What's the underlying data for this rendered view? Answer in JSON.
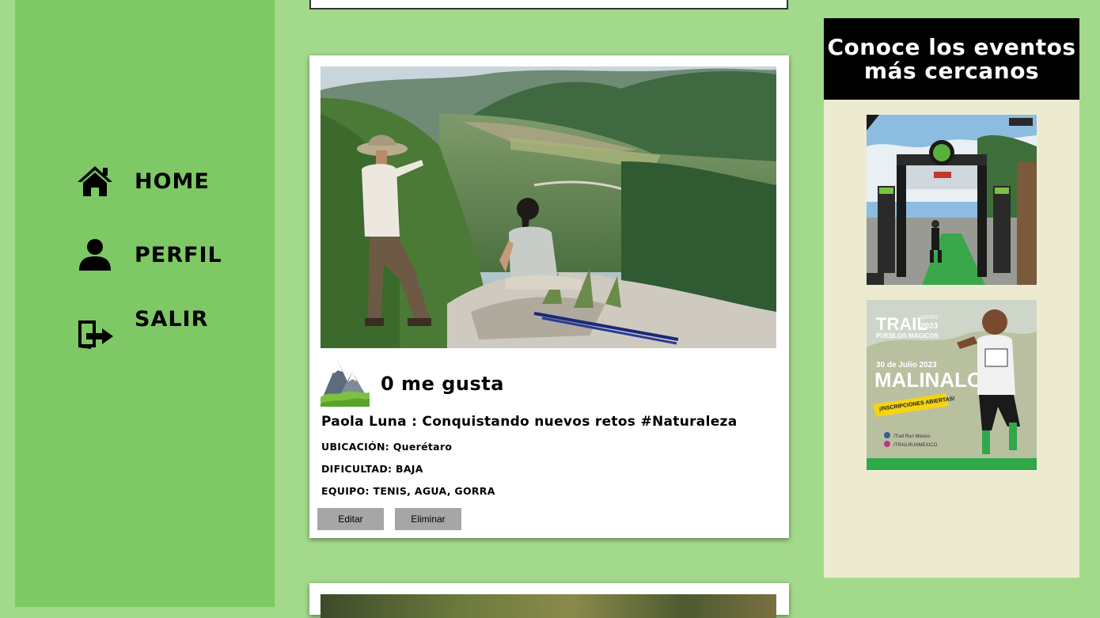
{
  "nav": {
    "home": "HOME",
    "profile": "PERFIL",
    "logout": "SALIR"
  },
  "post": {
    "likes": "0 me gusta",
    "caption": "Paola Luna : Conquistando nuevos retos #Naturaleza",
    "location": "UBICACIÓN: Querétaro",
    "difficulty": "DIFICULTAD: BAJA",
    "equipment": "EQUIPO: TENIS, AGUA, GORRA",
    "edit_label": "Editar",
    "delete_label": "Eliminar"
  },
  "events": {
    "title": "Conoce los eventos más cercanos",
    "poster2": {
      "brand": "TRAIL",
      "subtitle": "PUEBLOS MÁGICOS",
      "year": "2023",
      "series": "SERIES",
      "date": "30 de Julio 2023",
      "place": "MALINALCO",
      "ribbon": "¡INSCRIPCIONES ABIERTAS!",
      "fb": "/Trail Run México",
      "ig": "/TRAILRUNMEXICO"
    }
  },
  "colors": {
    "page_bg": "#a3d98b",
    "sidebar_bg": "#7ec965",
    "events_bg": "#ecebd1",
    "button_bg": "#a6a6a6"
  }
}
